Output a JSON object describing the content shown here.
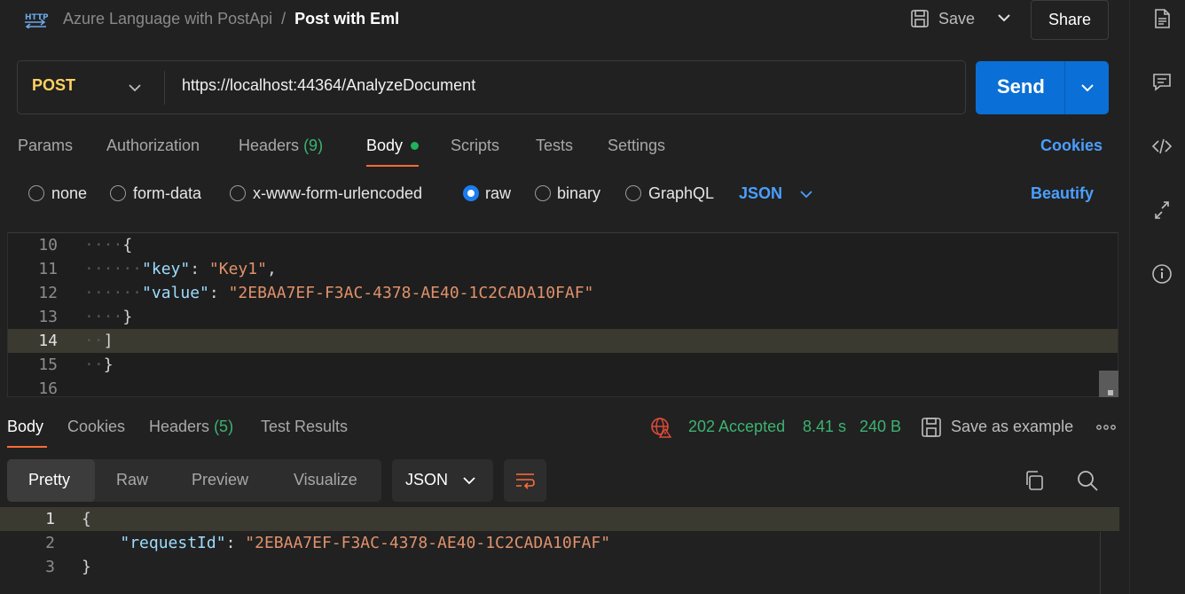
{
  "header": {
    "collection": "Azure Language with PostApi",
    "separator": "/",
    "request_name": "Post with Eml",
    "save_label": "Save",
    "share_label": "Share"
  },
  "request": {
    "method": "POST",
    "url": "https://localhost:44364/AnalyzeDocument",
    "send_label": "Send"
  },
  "request_tabs": {
    "params": "Params",
    "authorization": "Authorization",
    "headers": "Headers",
    "headers_count": "(9)",
    "body": "Body",
    "scripts": "Scripts",
    "tests": "Tests",
    "settings": "Settings",
    "cookies": "Cookies"
  },
  "body_types": {
    "none": "none",
    "form_data": "form-data",
    "urlencoded": "x-www-form-urlencoded",
    "raw": "raw",
    "binary": "binary",
    "graphql": "GraphQL",
    "format": "JSON",
    "beautify": "Beautify",
    "selected": "raw"
  },
  "editor": {
    "lines": [
      {
        "n": "10",
        "indent": "····",
        "parts": [
          {
            "t": "{",
            "c": "punct"
          }
        ]
      },
      {
        "n": "11",
        "indent": "······",
        "parts": [
          {
            "t": "\"key\"",
            "c": "key"
          },
          {
            "t": ": ",
            "c": "punct"
          },
          {
            "t": "\"Key1\"",
            "c": "str"
          },
          {
            "t": ",",
            "c": "punct"
          }
        ]
      },
      {
        "n": "12",
        "indent": "······",
        "parts": [
          {
            "t": "\"value\"",
            "c": "key"
          },
          {
            "t": ": ",
            "c": "punct"
          },
          {
            "t": "\"2EBAA7EF-F3AC-4378-AE40-1C2CADA10FAF\"",
            "c": "str"
          }
        ]
      },
      {
        "n": "13",
        "indent": "····",
        "parts": [
          {
            "t": "}",
            "c": "punct"
          }
        ]
      },
      {
        "n": "14",
        "indent": "··",
        "parts": [
          {
            "t": "]",
            "c": "punct"
          }
        ]
      },
      {
        "n": "15",
        "indent": "··",
        "parts": [
          {
            "t": "}",
            "c": "punct"
          }
        ]
      },
      {
        "n": "16",
        "indent": "",
        "parts": []
      }
    ],
    "current_line": "14"
  },
  "response_tabs": {
    "body": "Body",
    "cookies": "Cookies",
    "headers": "Headers",
    "headers_count": "(5)",
    "test_results": "Test Results"
  },
  "response_meta": {
    "status": "202 Accepted",
    "time": "8.41 s",
    "size": "240 B",
    "save_example": "Save as example"
  },
  "response_views": {
    "pretty": "Pretty",
    "raw": "Raw",
    "preview": "Preview",
    "visualize": "Visualize",
    "format": "JSON"
  },
  "response_body": {
    "lines": [
      {
        "n": "1",
        "indent": "",
        "parts": [
          {
            "t": "{",
            "c": "punct"
          }
        ]
      },
      {
        "n": "2",
        "indent": "    ",
        "parts": [
          {
            "t": "\"requestId\"",
            "c": "key"
          },
          {
            "t": ": ",
            "c": "punct"
          },
          {
            "t": "\"2EBAA7EF-F3AC-4378-AE40-1C2CADA10FAF\"",
            "c": "str"
          }
        ]
      },
      {
        "n": "3",
        "indent": "",
        "parts": [
          {
            "t": "}",
            "c": "punct"
          }
        ]
      }
    ]
  },
  "colors": {
    "accent_orange": "#ff6c37",
    "send_blue": "#0a6fd6",
    "link_blue": "#4a9fff",
    "status_green": "#3cb371",
    "method_yellow": "#ffd262"
  },
  "icons": {
    "logo": "http-logo-icon",
    "save": "save-disk-icon",
    "sidebar": [
      "document-icon",
      "comment-icon",
      "code-icon",
      "arrows-icon",
      "info-icon"
    ]
  }
}
